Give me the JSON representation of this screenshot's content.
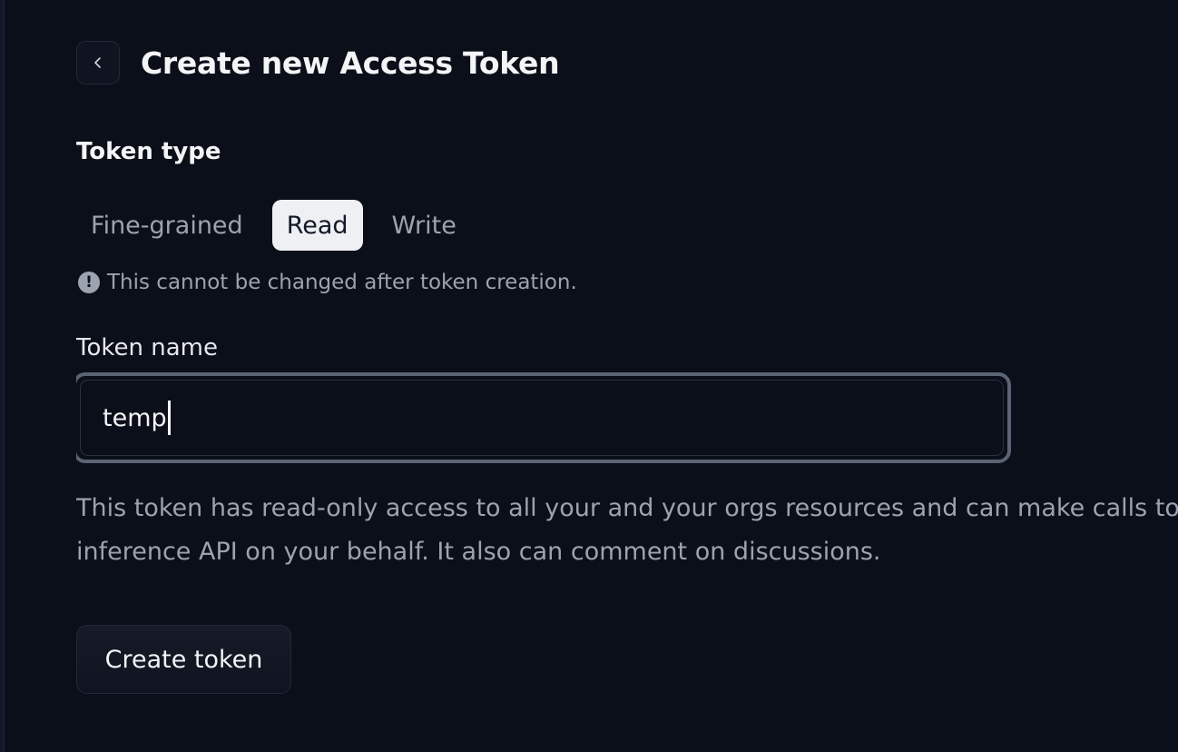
{
  "header": {
    "title": "Create new Access Token",
    "back_icon": "chevron-left-icon"
  },
  "token_type": {
    "label": "Token type",
    "options": [
      "Fine-grained",
      "Read",
      "Write"
    ],
    "selected": "Read",
    "note": "This cannot be changed after token creation.",
    "note_icon": "exclamation-circle-icon"
  },
  "token_name": {
    "label": "Token name",
    "value": "temp"
  },
  "description": "This token has read-only access to all your and your orgs resources and can make calls to inference API on your behalf. It also can comment on discussions.",
  "actions": {
    "create_label": "Create token"
  },
  "colors": {
    "background": "#0b0f19",
    "selected_tab": "#eef0f3",
    "muted_text": "#9ca3af",
    "input_focus_ring": "#5a6474"
  }
}
